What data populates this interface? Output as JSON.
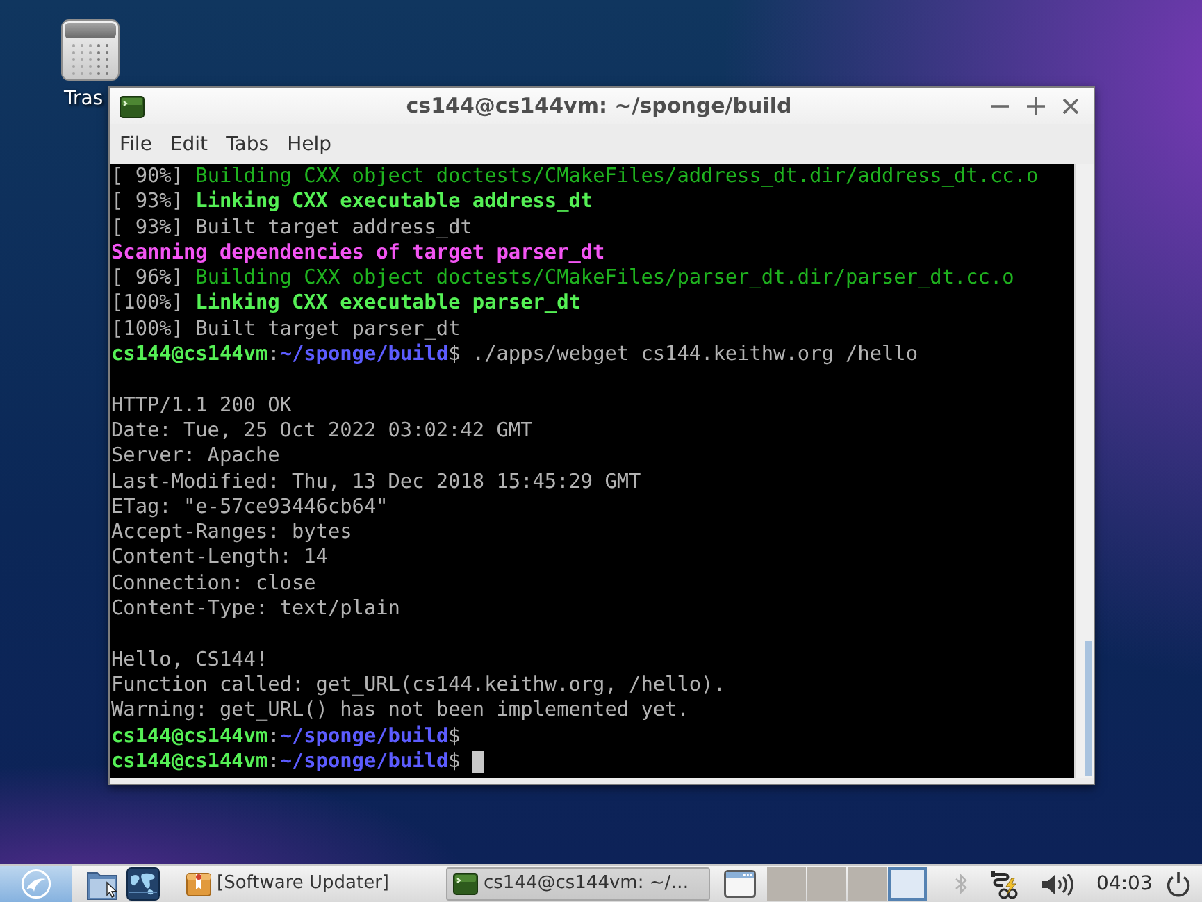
{
  "desktop": {
    "icons": [
      {
        "label": "Tras"
      }
    ]
  },
  "window": {
    "title": "cs144@cs144vm: ~/sponge/build",
    "menu": [
      "File",
      "Edit",
      "Tabs",
      "Help"
    ],
    "terminal": {
      "cursor": true,
      "lines": [
        {
          "kind": "text",
          "segments": [
            {
              "text": "[ 90%] ",
              "color": "#b2b2b2",
              "bold": false
            },
            {
              "text": "Building CXX object doctests/CMakeFiles/address_dt.dir/address_dt.cc.o",
              "color": "#1fb21f",
              "bold": false
            }
          ]
        },
        {
          "kind": "text",
          "segments": [
            {
              "text": "[ 93%] ",
              "color": "#b2b2b2",
              "bold": false
            },
            {
              "text": "Linking CXX executable address_dt",
              "color": "#55f055",
              "bold": true
            }
          ]
        },
        {
          "kind": "text",
          "segments": [
            {
              "text": "[ 93%] Built target address_dt",
              "color": "#b2b2b2",
              "bold": false
            }
          ]
        },
        {
          "kind": "text",
          "segments": [
            {
              "text": "Scanning dependencies of target parser_dt",
              "color": "#f355f3",
              "bold": true
            }
          ]
        },
        {
          "kind": "text",
          "segments": [
            {
              "text": "[ 96%] ",
              "color": "#b2b2b2",
              "bold": false
            },
            {
              "text": "Building CXX object doctests/CMakeFiles/parser_dt.dir/parser_dt.cc.o",
              "color": "#1fb21f",
              "bold": false
            }
          ]
        },
        {
          "kind": "text",
          "segments": [
            {
              "text": "[100%] ",
              "color": "#b2b2b2",
              "bold": false
            },
            {
              "text": "Linking CXX executable parser_dt",
              "color": "#55f055",
              "bold": true
            }
          ]
        },
        {
          "kind": "text",
          "segments": [
            {
              "text": "[100%] Built target parser_dt",
              "color": "#b2b2b2",
              "bold": false
            }
          ]
        },
        {
          "kind": "text",
          "segments": [
            {
              "text": "cs144@cs144vm",
              "color": "#55f055",
              "bold": true
            },
            {
              "text": ":",
              "color": "#b2b2b2",
              "bold": false
            },
            {
              "text": "~/sponge/build",
              "color": "#5c5cff",
              "bold": true
            },
            {
              "text": "$ ./apps/webget cs144.keithw.org /hello",
              "color": "#b2b2b2",
              "bold": false
            }
          ]
        },
        {
          "kind": "blank"
        },
        {
          "kind": "text",
          "segments": [
            {
              "text": "HTTP/1.1 200 OK",
              "color": "#b2b2b2",
              "bold": false
            }
          ]
        },
        {
          "kind": "text",
          "segments": [
            {
              "text": "Date: Tue, 25 Oct 2022 03:02:42 GMT",
              "color": "#b2b2b2",
              "bold": false
            }
          ]
        },
        {
          "kind": "text",
          "segments": [
            {
              "text": "Server: Apache",
              "color": "#b2b2b2",
              "bold": false
            }
          ]
        },
        {
          "kind": "text",
          "segments": [
            {
              "text": "Last-Modified: Thu, 13 Dec 2018 15:45:29 GMT",
              "color": "#b2b2b2",
              "bold": false
            }
          ]
        },
        {
          "kind": "text",
          "segments": [
            {
              "text": "ETag: \"e-57ce93446cb64\"",
              "color": "#b2b2b2",
              "bold": false
            }
          ]
        },
        {
          "kind": "text",
          "segments": [
            {
              "text": "Accept-Ranges: bytes",
              "color": "#b2b2b2",
              "bold": false
            }
          ]
        },
        {
          "kind": "text",
          "segments": [
            {
              "text": "Content-Length: 14",
              "color": "#b2b2b2",
              "bold": false
            }
          ]
        },
        {
          "kind": "text",
          "segments": [
            {
              "text": "Connection: close",
              "color": "#b2b2b2",
              "bold": false
            }
          ]
        },
        {
          "kind": "text",
          "segments": [
            {
              "text": "Content-Type: text/plain",
              "color": "#b2b2b2",
              "bold": false
            }
          ]
        },
        {
          "kind": "blank"
        },
        {
          "kind": "text",
          "segments": [
            {
              "text": "Hello, CS144!",
              "color": "#b2b2b2",
              "bold": false
            }
          ]
        },
        {
          "kind": "text",
          "segments": [
            {
              "text": "Function called: get_URL(cs144.keithw.org, /hello).",
              "color": "#b2b2b2",
              "bold": false
            }
          ]
        },
        {
          "kind": "text",
          "segments": [
            {
              "text": "Warning: get_URL() has not been implemented yet.",
              "color": "#b2b2b2",
              "bold": false
            }
          ]
        },
        {
          "kind": "text",
          "segments": [
            {
              "text": "cs144@cs144vm",
              "color": "#55f055",
              "bold": true
            },
            {
              "text": ":",
              "color": "#b2b2b2",
              "bold": false
            },
            {
              "text": "~/sponge/build",
              "color": "#5c5cff",
              "bold": true
            },
            {
              "text": "$",
              "color": "#b2b2b2",
              "bold": false
            }
          ]
        },
        {
          "kind": "text",
          "segments": [
            {
              "text": "cs144@cs144vm",
              "color": "#55f055",
              "bold": true
            },
            {
              "text": ":",
              "color": "#b2b2b2",
              "bold": false
            },
            {
              "text": "~/sponge/build",
              "color": "#5c5cff",
              "bold": true
            },
            {
              "text": "$ ",
              "color": "#b2b2b2",
              "bold": false
            }
          ]
        }
      ]
    }
  },
  "taskbar": {
    "tasks": [
      {
        "kind": "updater",
        "label": "[Software Updater]",
        "selected": false
      },
      {
        "kind": "terminal",
        "label": "cs144@cs144vm: ~/…",
        "selected": true
      }
    ],
    "workspaces": [
      {
        "selected": false
      },
      {
        "selected": false
      },
      {
        "selected": false
      },
      {
        "selected": true
      }
    ],
    "clock": "04:03"
  }
}
